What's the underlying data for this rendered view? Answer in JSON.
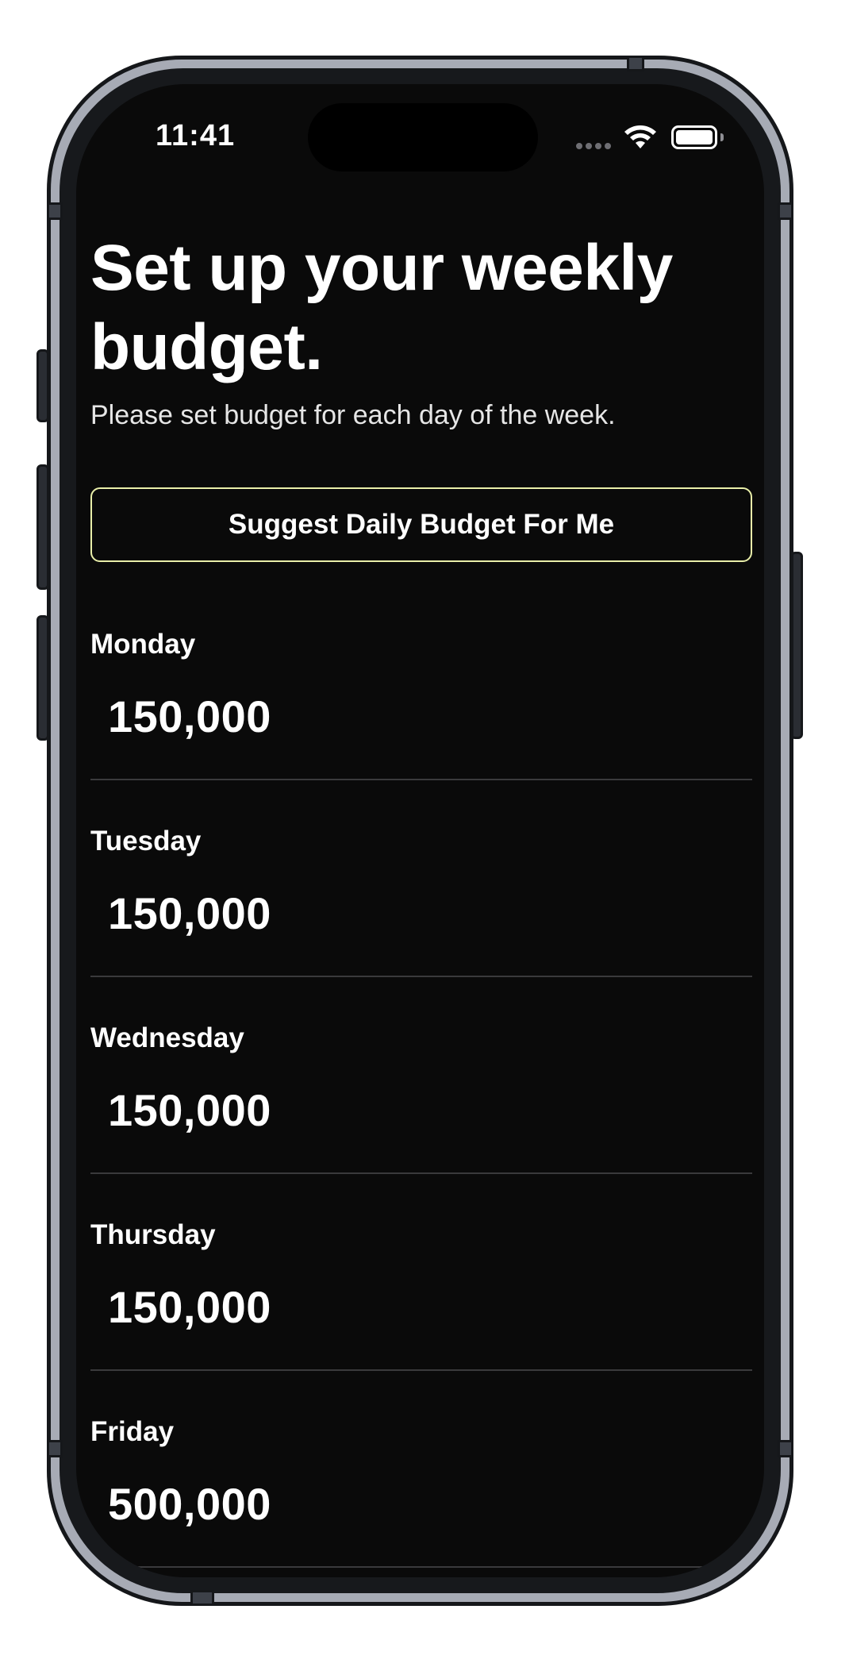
{
  "status_bar": {
    "time": "11:41",
    "icons": [
      "signal-icon",
      "wifi-icon",
      "battery-icon"
    ]
  },
  "header": {
    "title": "Set up your weekly budget.",
    "subtitle": "Please set budget for each day of the week."
  },
  "suggest_button": {
    "label": "Suggest Daily Budget For Me"
  },
  "days": [
    {
      "label": "Monday",
      "value": "150,000"
    },
    {
      "label": "Tuesday",
      "value": "150,000"
    },
    {
      "label": "Wednesday",
      "value": "150,000"
    },
    {
      "label": "Thursday",
      "value": "150,000"
    },
    {
      "label": "Friday",
      "value": "500,000"
    }
  ],
  "colors": {
    "background": "#0a0a0a",
    "text": "#ffffff",
    "button_border": "#e9efa9",
    "divider": "#3a3a3c"
  }
}
